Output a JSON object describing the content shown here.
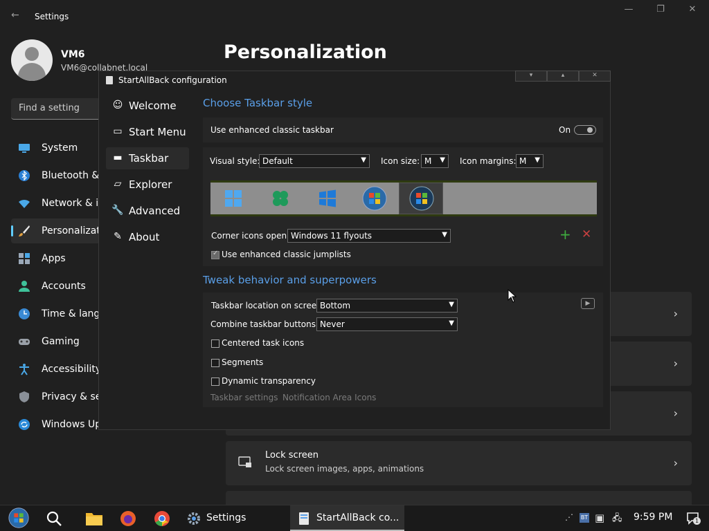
{
  "settings": {
    "title": "Settings",
    "user": {
      "name": "VM6",
      "email": "VM6@collabnet.local"
    },
    "search_placeholder": "Find a setting",
    "nav": [
      {
        "label": "System"
      },
      {
        "label": "Bluetooth & d"
      },
      {
        "label": "Network & in"
      },
      {
        "label": "Personalizatio"
      },
      {
        "label": "Apps"
      },
      {
        "label": "Accounts"
      },
      {
        "label": "Time & langu"
      },
      {
        "label": "Gaming"
      },
      {
        "label": "Accessibility"
      },
      {
        "label": "Privacy & sec"
      },
      {
        "label": "Windows Upd"
      }
    ],
    "page_title": "Personalization",
    "lock_screen": {
      "title": "Lock screen",
      "subtitle": "Lock screen images, apps, animations"
    }
  },
  "sab": {
    "title": "StartAllBack configuration",
    "sidebar": [
      {
        "icon": "☺",
        "label": "Welcome"
      },
      {
        "icon": "▭",
        "label": "Start Menu"
      },
      {
        "icon": "▬",
        "label": "Taskbar"
      },
      {
        "icon": "▱",
        "label": "Explorer"
      },
      {
        "icon": "🔧",
        "label": "Advanced"
      },
      {
        "icon": "✎",
        "label": "About"
      }
    ],
    "section1": "Choose Taskbar style",
    "enhanced_label": "Use enhanced classic taskbar",
    "enhanced_state": "On",
    "visual_style_label": "Visual style:",
    "visual_style_value": "Default",
    "icon_size_label": "Icon size:",
    "icon_size_value": "M",
    "icon_margins_label": "Icon margins:",
    "icon_margins_value": "M",
    "corner_label": "Corner icons open:",
    "corner_value": "Windows 11 flyouts",
    "jumplists_label": "Use enhanced classic jumplists",
    "section2": "Tweak behavior and superpowers",
    "location_label": "Taskbar location on screen:",
    "location_value": "Bottom",
    "combine_label": "Combine taskbar buttons:",
    "combine_value": "Never",
    "centered_label": "Centered task icons",
    "segments_label": "Segments",
    "dynamic_label": "Dynamic transparency",
    "link1": "Taskbar settings",
    "link2": "Notification Area Icons"
  },
  "taskbar": {
    "settings_label": "Settings",
    "sab_label": "StartAllBack co...",
    "clock": "9:59 PM",
    "tray_bt": "BT",
    "notif_count": "1"
  },
  "colors": {
    "accent": "#60cdff",
    "heading": "#5a9fe8",
    "add": "#3fae3f",
    "remove": "#c84040"
  }
}
